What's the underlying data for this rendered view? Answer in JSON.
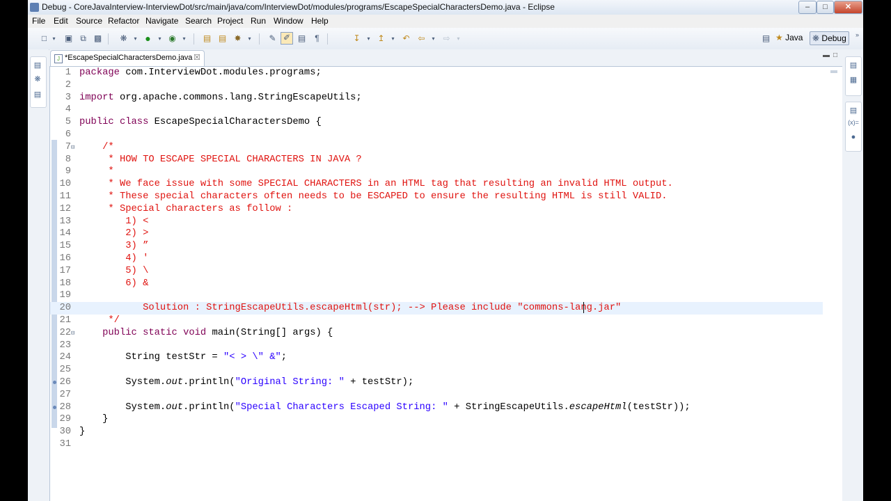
{
  "window": {
    "title": "Debug - CoreJavaInterview-InterviewDot/src/main/java/com/InterviewDot/modules/programs/EscapeSpecialCharactersDemo.java - Eclipse",
    "minimize": "–",
    "maximize": "□",
    "close": "✕"
  },
  "menu": [
    "File",
    "Edit",
    "Source",
    "Refactor",
    "Navigate",
    "Search",
    "Project",
    "Run",
    "Window",
    "Help"
  ],
  "perspectives": {
    "java": "Java",
    "debug": "Debug"
  },
  "editor": {
    "tab_label": "*EscapeSpecialCharactersDemo.java",
    "tab_close": "☒",
    "current_line": 20,
    "lines": [
      {
        "n": "1",
        "html": "package com.InterviewDot.modules.programs;"
      },
      {
        "n": "2",
        "html": ""
      },
      {
        "n": "3",
        "html": "import org.apache.commons.lang.StringEscapeUtils;"
      },
      {
        "n": "4",
        "html": ""
      },
      {
        "n": "5",
        "html": "public class EscapeSpecialCharactersDemo {"
      },
      {
        "n": "6",
        "html": ""
      },
      {
        "n": "7",
        "html": "    /*"
      },
      {
        "n": "8",
        "html": "     * HOW TO ESCAPE SPECIAL CHARACTERS IN JAVA ?"
      },
      {
        "n": "9",
        "html": "     *"
      },
      {
        "n": "10",
        "html": "     * We face issue with some SPECIAL CHARACTERS in an HTML tag that resulting an invalid HTML output."
      },
      {
        "n": "11",
        "html": "     * These special characters often needs to be ESCAPED to ensure the resulting HTML is still VALID."
      },
      {
        "n": "12",
        "html": "     * Special characters as follow :"
      },
      {
        "n": "13",
        "html": "        1) <"
      },
      {
        "n": "14",
        "html": "        2) >"
      },
      {
        "n": "15",
        "html": "        3) ”"
      },
      {
        "n": "16",
        "html": "        4) '"
      },
      {
        "n": "17",
        "html": "        5) \\"
      },
      {
        "n": "18",
        "html": "        6) &"
      },
      {
        "n": "19",
        "html": ""
      },
      {
        "n": "20",
        "html": "           Solution : StringEscapeUtils.escapeHtml(str); --> Please include \"commons-lang.jar\""
      },
      {
        "n": "21",
        "html": "     */"
      },
      {
        "n": "22",
        "html": "    public static void main(String[] args) {"
      },
      {
        "n": "23",
        "html": ""
      },
      {
        "n": "24",
        "html": "        String testStr = \"< > \\\" &\";"
      },
      {
        "n": "25",
        "html": ""
      },
      {
        "n": "26",
        "html": "        System.out.println(\"Original String: \" + testStr);"
      },
      {
        "n": "27",
        "html": ""
      },
      {
        "n": "28",
        "html": "        System.out.println(\"Special Characters Escaped String: \" + StringEscapeUtils.escapeHtml(testStr));"
      },
      {
        "n": "29",
        "html": "    }"
      },
      {
        "n": "30",
        "html": "}"
      },
      {
        "n": "31",
        "html": ""
      }
    ]
  }
}
